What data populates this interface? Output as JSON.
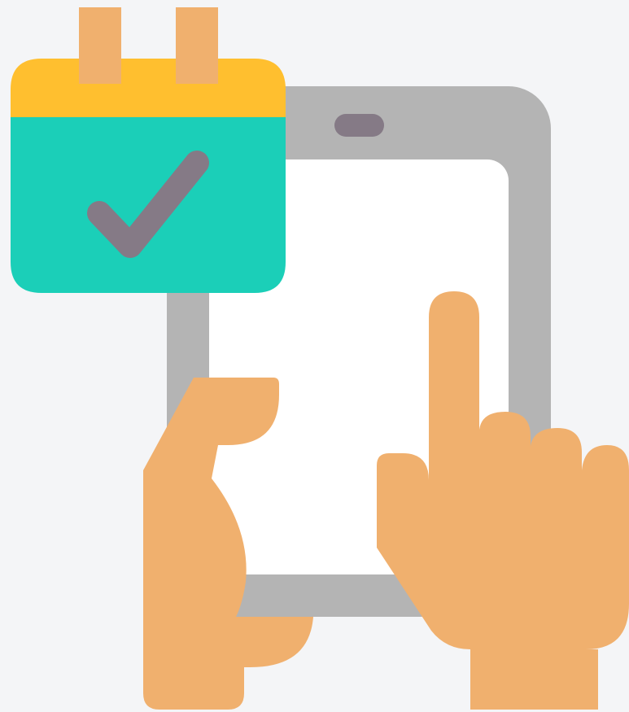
{
  "scene": {
    "subject": "calendar-check-phone-booking",
    "icons": [
      "calendar-check-icon",
      "smartphone-icon",
      "left-hand-icon",
      "pointing-hand-icon"
    ]
  },
  "colors": {
    "background": "#f4f5f7",
    "calendar_header": "#ffbf2f",
    "calendar_body": "#1bcfb8",
    "calendar_rings": "#f0b06e",
    "checkmark": "#857a86",
    "phone_frame": "#b4b4b4",
    "phone_screen": "#ffffff",
    "phone_speaker": "#857a86",
    "skin": "#f0b06e"
  }
}
